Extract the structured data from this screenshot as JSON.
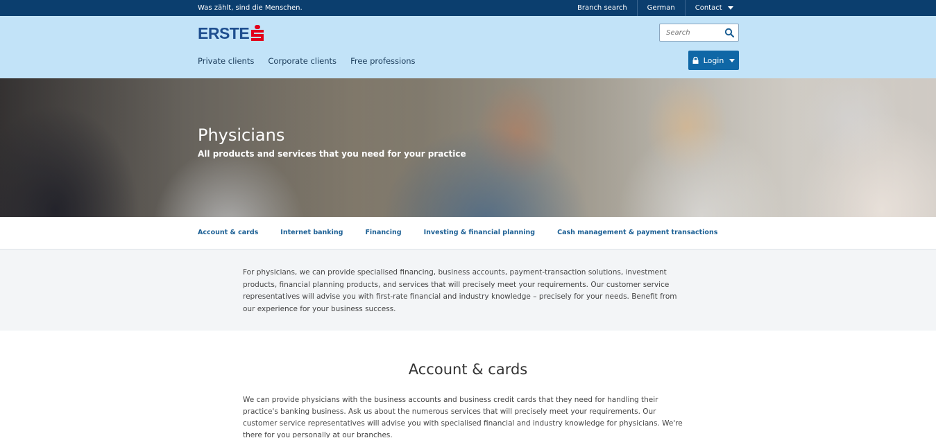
{
  "topbar": {
    "tagline": "Was zählt, sind die Menschen.",
    "links": {
      "branch_search": "Branch search",
      "language": "German",
      "contact": "Contact"
    }
  },
  "header": {
    "logo_text": "ERSTE",
    "nav": {
      "private": "Private clients",
      "corporate": "Corporate clients",
      "free": "Free professions"
    },
    "search_placeholder": "Search",
    "login_label": "Login"
  },
  "hero": {
    "title": "Physicians",
    "subtitle": "All products and services that you need for your practice"
  },
  "subnav": {
    "items": [
      "Account & cards",
      "Internet banking",
      "Financing",
      "Investing & financial planning",
      "Cash management & payment transactions"
    ]
  },
  "intro": {
    "text": "For physicians, we can provide specialised financing, business accounts, payment-transaction solutions, investment products, financial planning products, and services that will precisely meet your requirements.  Our customer service representatives will advise you with first-rate financial and industry knowledge – precisely for your needs. Benefit from our experience for your business success."
  },
  "section": {
    "title": "Account & cards",
    "text": "We can provide physicians with the business accounts and business credit cards that they need for handling their practice's banking business. Ask us about the numerous services that will precisely meet your requirements. Our customer service representatives will advise you with specialised financial and industry knowledge for physicians. We're there for you personally at our branches."
  },
  "colors": {
    "topbar": "#0b3e6e",
    "header": "#c2e3f8",
    "brand_blue": "#1e4e8f",
    "brand_red": "#e2001a",
    "login_button": "#0f67a6",
    "link": "#1b5f94"
  }
}
